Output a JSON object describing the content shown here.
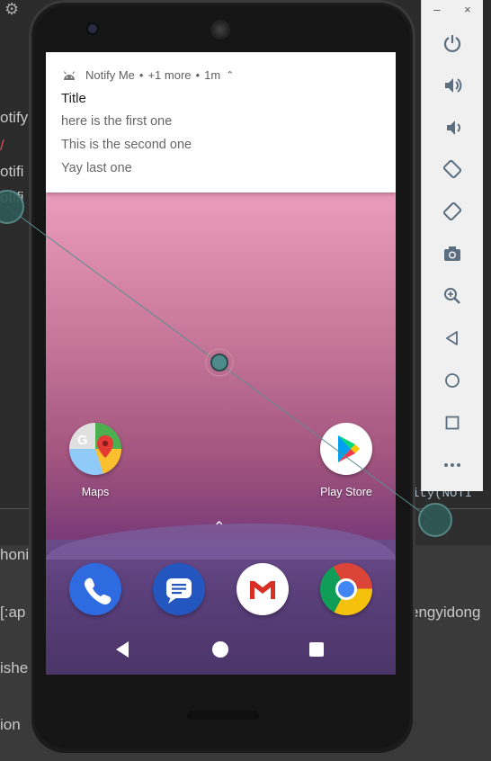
{
  "ide": {
    "left_texts": [
      "otify",
      "/",
      "otifi",
      "otifi"
    ],
    "bottom_texts": [
      "honi",
      "[:ap",
      "ishe",
      "ion"
    ],
    "right_bottom_text": "engyidong",
    "right_code_text": "ity(NOTI"
  },
  "notification": {
    "app_name": "Notify Me",
    "more": "+1 more",
    "time": "1m",
    "title": "Title",
    "lines": [
      "here is the first one",
      "This is the second one",
      "Yay last one"
    ]
  },
  "apps": {
    "maps_label": "Maps",
    "play_label": "Play Store"
  },
  "dock": [
    "phone-app",
    "messages-app",
    "gmail-app",
    "chrome-app"
  ],
  "toolbar": {
    "minimize": "–",
    "close": "×",
    "buttons": [
      "power-icon",
      "volume-up-icon",
      "volume-down-icon",
      "rotate-left-icon",
      "rotate-right-icon",
      "camera-icon",
      "zoom-icon",
      "back-icon",
      "home-icon",
      "overview-icon",
      "more-icon"
    ]
  },
  "colors": {
    "accent": "#5b6f80",
    "touch": "#5a8f8f"
  }
}
